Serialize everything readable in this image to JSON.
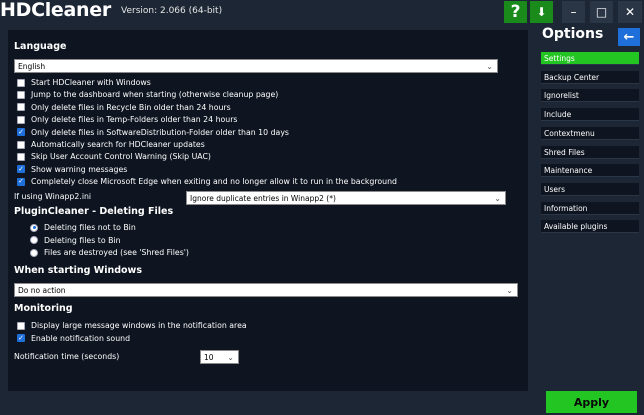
{
  "window": {
    "title": "HDCleaner",
    "version": "Version: 2.066 (64-bit)",
    "help_glyph": "?",
    "download_glyph": "⬇",
    "min_glyph": "–",
    "max_glyph": "□",
    "close_glyph": "✕"
  },
  "language": {
    "heading": "Language",
    "selected": "English"
  },
  "general_options": [
    {
      "label": "Start HDCleaner with Windows",
      "checked": false
    },
    {
      "label": "Jump to the dashboard when starting (otherwise cleanup page)",
      "checked": false
    },
    {
      "label": "Only delete files in Recycle Bin older than 24 hours",
      "checked": false
    },
    {
      "label": "Only delete files in Temp-Folders older than 24 hours",
      "checked": false
    },
    {
      "label": "Only delete files in SoftwareDistribution-Folder older than 10 days",
      "checked": true
    },
    {
      "label": "Automatically search for HDCleaner updates",
      "checked": false
    },
    {
      "label": "Skip User Account Control Warning (Skip UAC)",
      "checked": false
    },
    {
      "label": "Show warning messages",
      "checked": true
    },
    {
      "label": "Completely close Microsoft Edge when exiting and no longer allow it to run in the background",
      "checked": true
    }
  ],
  "winapp2": {
    "label": "If using Winapp2.ini",
    "selected": "Ignore duplicate entries in Winapp2 (*)"
  },
  "plugincleaner": {
    "heading": "PluginCleaner - Deleting Files",
    "options": [
      {
        "label": "Deleting files not to Bin",
        "checked": true
      },
      {
        "label": "Deleting files to Bin",
        "checked": false
      },
      {
        "label": "Files are destroyed (see 'Shred Files')",
        "checked": false
      }
    ]
  },
  "starting_windows": {
    "heading": "When starting Windows",
    "selected": "Do no action"
  },
  "monitoring": {
    "heading": "Monitoring",
    "options": [
      {
        "label": "Display large message windows in the notification area",
        "checked": false
      },
      {
        "label": "Enable notification sound",
        "checked": true
      }
    ],
    "notification_label": "Notification time (seconds)",
    "notification_value": "10"
  },
  "sidebar": {
    "title": "Options",
    "back_glyph": "←",
    "items": [
      {
        "label": "Settings",
        "active": true
      },
      {
        "label": "Backup Center",
        "active": false
      },
      {
        "label": "Ignorelist",
        "active": false
      },
      {
        "label": "Include",
        "active": false
      },
      {
        "label": "Contextmenu",
        "active": false
      },
      {
        "label": "Shred Files",
        "active": false
      },
      {
        "label": "Maintenance",
        "active": false
      },
      {
        "label": "Users",
        "active": false
      },
      {
        "label": "Information",
        "active": false
      },
      {
        "label": "Available plugins",
        "active": false
      }
    ]
  },
  "apply_label": "Apply",
  "chevron_glyph": "⌄",
  "colors": {
    "background": "#1c2634",
    "panel": "#0e1520",
    "accent_green": "#22c522",
    "accent_blue": "#1e6fd9"
  }
}
